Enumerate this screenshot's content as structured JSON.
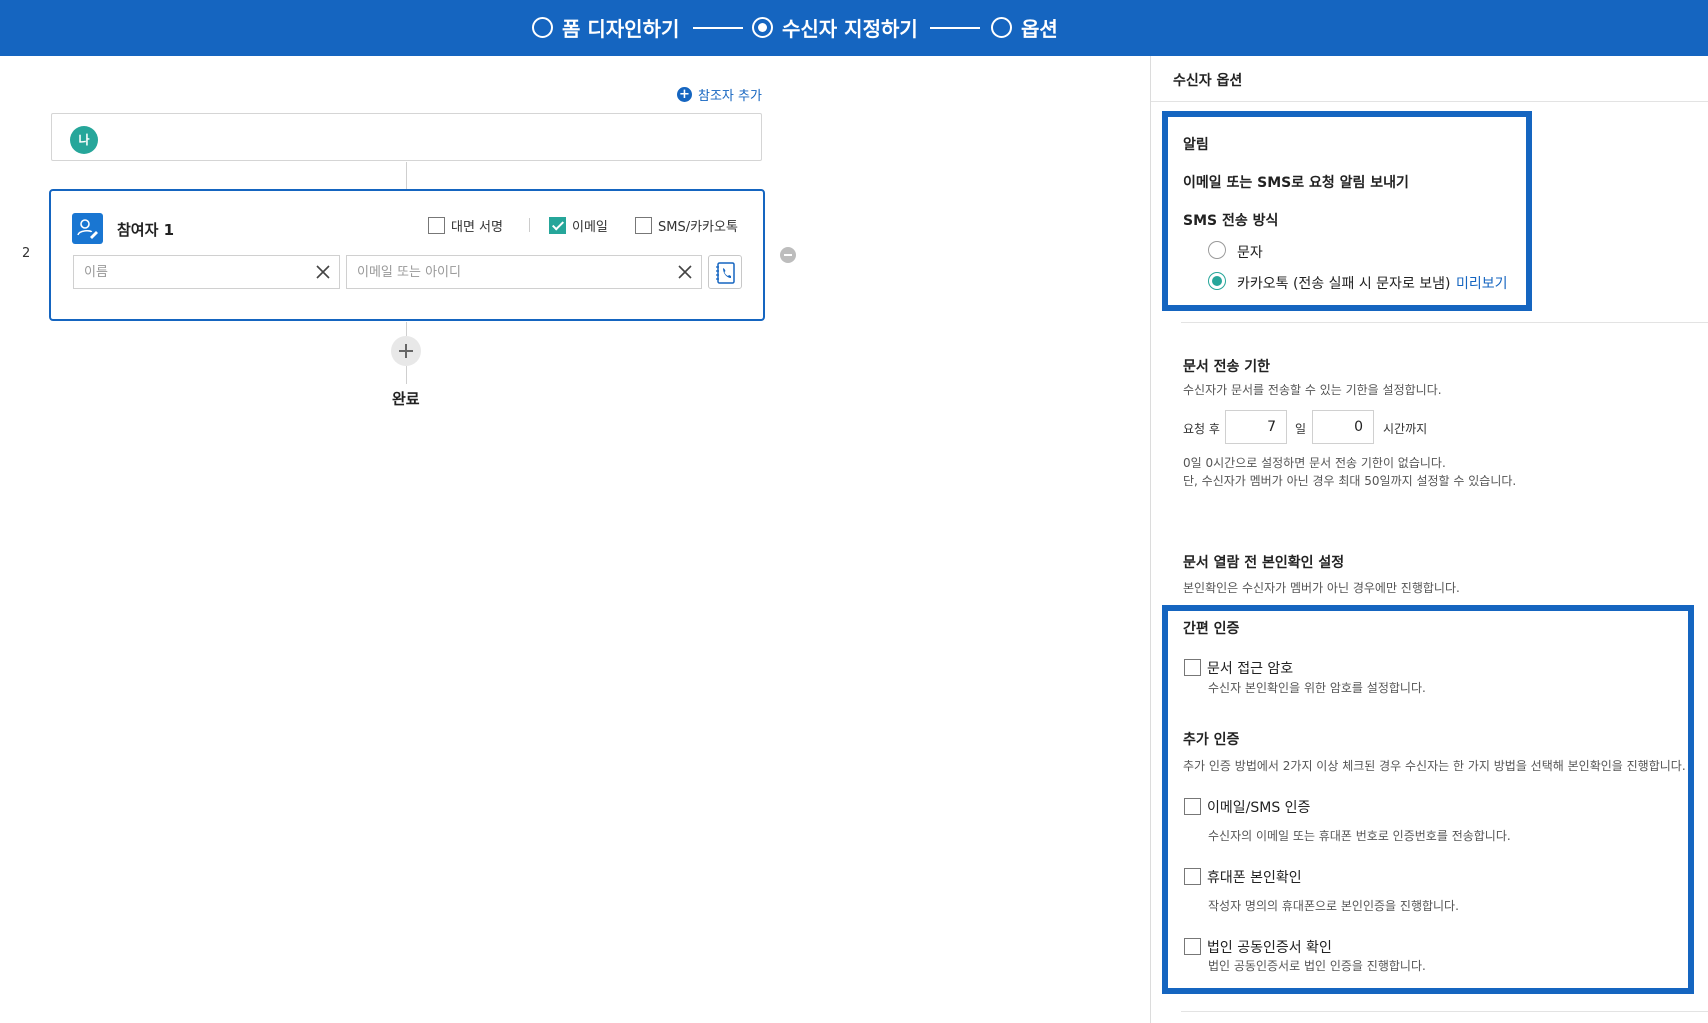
{
  "stepper": {
    "steps": [
      {
        "label": "폼 디자인하기",
        "active": false
      },
      {
        "label": "수신자 지정하기",
        "active": true
      },
      {
        "label": "옵션",
        "active": false
      }
    ]
  },
  "flow": {
    "add_referrer_label": "참조자 추가",
    "me_avatar": "나",
    "order_number": "2",
    "participant": {
      "title": "참여자 1",
      "options": [
        {
          "label": "대면 서명",
          "checked": false
        },
        {
          "label": "이메일",
          "checked": true
        },
        {
          "label": "SMS/카카오톡",
          "checked": false
        }
      ],
      "name_placeholder": "이름",
      "email_placeholder": "이메일 또는 아이디"
    },
    "done_label": "완료"
  },
  "panel": {
    "title": "수신자 옵션",
    "notification": {
      "title": "알림",
      "send_label": "이메일 또는 SMS로 요청 알림 보내기",
      "sms_method_title": "SMS 전송 방식",
      "radio_text": "문자",
      "radio_kakao": "카카오톡 (전송 실패 시 문자로 보냄)",
      "selected": "kakao",
      "preview_link": "미리보기"
    },
    "deadline": {
      "title": "문서 전송 기한",
      "desc": "수신자가 문서를 전송할 수 있는 기한을 설정합니다.",
      "prefix": "요청 후",
      "days": "7",
      "days_unit": "일",
      "hours": "0",
      "hours_unit": "시간까지",
      "note1": "0일 0시간으로 설정하면 문서 전송 기한이 없습니다.",
      "note2": "단, 수신자가 멤버가 아닌 경우 최대 50일까지 설정할 수 있습니다."
    },
    "identity": {
      "title": "문서 열람 전 본인확인 설정",
      "desc": "본인확인은 수신자가 멤버가 아닌 경우에만 진행합니다.",
      "simple_title": "간편 인증",
      "password_label": "문서 접근 암호",
      "password_desc": "수신자 본인확인을 위한 암호를 설정합니다.",
      "extra_title": "추가 인증",
      "extra_desc": "추가 인증 방법에서 2가지 이상 체크된 경우 수신자는 한 가지 방법을 선택해 본인확인을 진행합니다.",
      "email_sms_label": "이메일/SMS 인증",
      "email_sms_desc": "수신자의 이메일 또는 휴대폰 번호로 인증번호를 전송합니다.",
      "phone_label": "휴대폰 본인확인",
      "phone_desc": "작성자 명의의 휴대폰으로 본인인증을 진행합니다.",
      "corp_cert_label": "법인 공동인증서 확인",
      "corp_cert_desc": "법인 공동인증서로 법인 인증을 진행합니다."
    }
  },
  "colors": {
    "primary": "#1565c0",
    "accent_teal": "#26a69a"
  }
}
